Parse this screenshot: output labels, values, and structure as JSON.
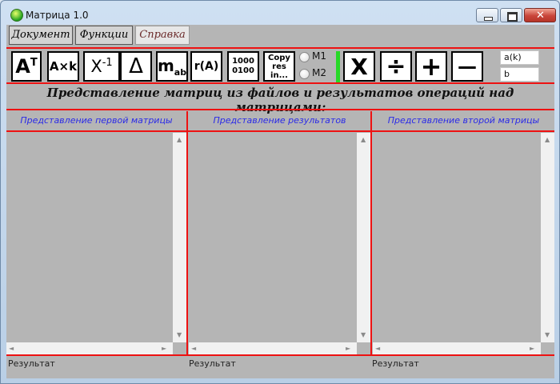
{
  "window": {
    "title": "Матрица 1.0",
    "controls": {
      "minimize": "minimize",
      "maximize": "maximize",
      "close": "✕"
    }
  },
  "menu": {
    "document": "Документ",
    "functions": "Функции",
    "help": "Справка"
  },
  "toolbar": {
    "transpose": {
      "base": "A",
      "sup": "T"
    },
    "multiply_scalar": "A×k",
    "inverse": {
      "base": "X",
      "sup": "-1"
    },
    "determinant": "Δ",
    "minor": {
      "base": "m",
      "sub": "ab"
    },
    "rank": "r(A)",
    "binary": [
      "1000",
      "0100"
    ],
    "copy_result": [
      "Copy",
      "res",
      "in..."
    ],
    "radio_m1": "M1",
    "radio_m2": "M2",
    "multiply": "X",
    "divide": "÷",
    "add": "+",
    "subtract": "—",
    "field_ak": "a(k)",
    "field_b": "b"
  },
  "heading": "Представление матриц из файлов и результатов операций над матрицами:",
  "panels": {
    "first": "Представление первой матрицы",
    "results": "Представление результатов",
    "second": "Представление второй матрицы"
  },
  "footer": {
    "result1": "Результат",
    "result2": "Результат",
    "result3": "Результат"
  }
}
